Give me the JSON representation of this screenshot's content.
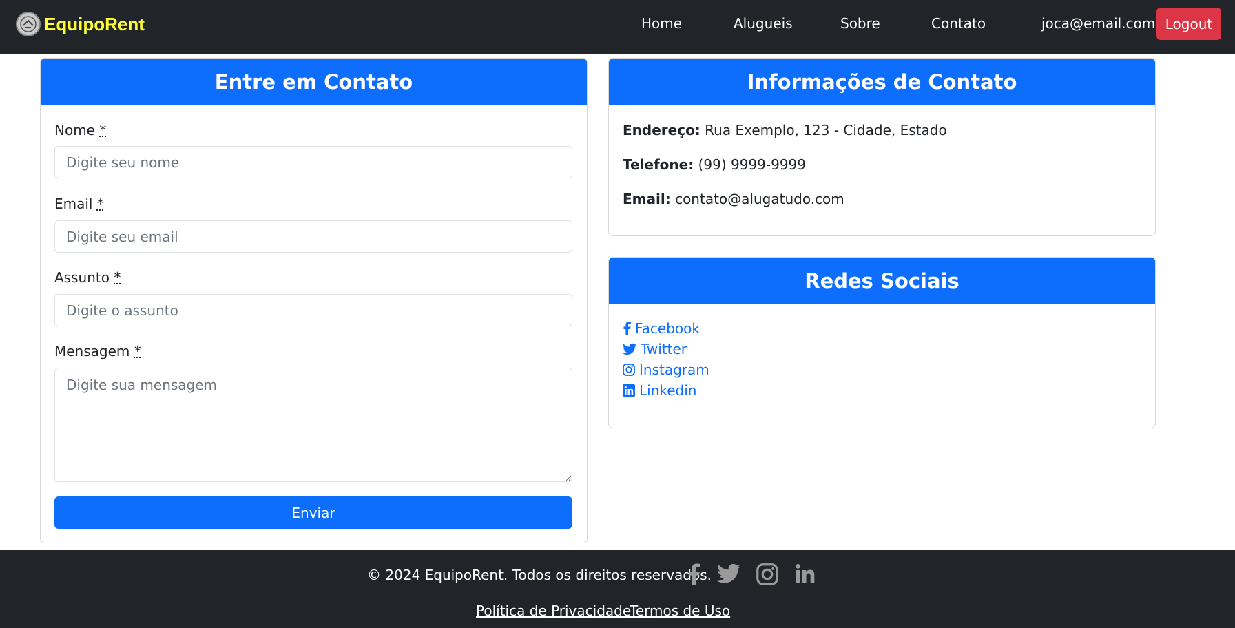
{
  "navbar": {
    "brand": "EquipoRent",
    "links": [
      "Home",
      "Alugueis",
      "Sobre",
      "Contato"
    ],
    "user_email": "joca@email.com",
    "logout_label": "Logout"
  },
  "contact_form": {
    "title": "Entre em Contato",
    "required_mark": "*",
    "fields": [
      {
        "label": "Nome",
        "placeholder": "Digite seu nome"
      },
      {
        "label": "Email",
        "placeholder": "Digite seu email"
      },
      {
        "label": "Assunto",
        "placeholder": "Digite o assunto"
      },
      {
        "label": "Mensagem",
        "placeholder": "Digite sua mensagem"
      }
    ],
    "submit_label": "Enviar"
  },
  "contact_info": {
    "title": "Informações de Contato",
    "items": [
      {
        "label": "Endereço:",
        "value": "Rua Exemplo, 123 - Cidade, Estado"
      },
      {
        "label": "Telefone:",
        "value": "(99) 9999-9999"
      },
      {
        "label": "Email:",
        "value": "contato@alugatudo.com"
      }
    ]
  },
  "social": {
    "title": "Redes Sociais",
    "links": [
      {
        "label": "Facebook",
        "icon": "facebook-icon"
      },
      {
        "label": "Twitter",
        "icon": "twitter-icon"
      },
      {
        "label": "Instagram",
        "icon": "instagram-icon"
      },
      {
        "label": "Linkedin",
        "icon": "linkedin-icon"
      }
    ]
  },
  "footer": {
    "copyright": "© 2024 EquipoRent. Todos os direitos reservados.",
    "links": [
      "Política de Privacidade",
      "Termos de Uso"
    ],
    "icons": [
      "facebook-icon",
      "twitter-icon",
      "instagram-icon",
      "linkedin-icon"
    ]
  },
  "colors": {
    "navbar_bg": "#212529",
    "brand": "#ffff33",
    "primary": "#0d6efd",
    "danger": "#dc3545"
  }
}
